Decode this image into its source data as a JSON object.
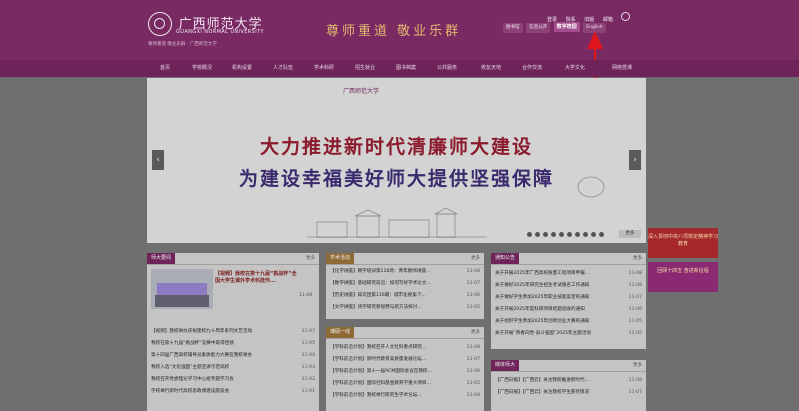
{
  "header": {
    "logo_cn": "广西师范大学",
    "logo_en": "GUANGXI NORMAL UNIVERSITY",
    "motto": "尊师重道 敬业乐群 · 广西师范大学",
    "slogan": "尊师重道  敬业乐群",
    "top_links": [
      "登录",
      "院系",
      "旧版",
      "邮箱"
    ],
    "toolbar": [
      "图书馆",
      "信息公开",
      "数字校园",
      "English"
    ],
    "toolbar_highlight": "数字校园"
  },
  "nav": {
    "items": [
      "首页",
      "学校概况",
      "机构设置",
      "人才队伍",
      "学术科研",
      "招生就业",
      "图书档案",
      "公共服务",
      "校友天地",
      "合作交流",
      "大学文化",
      "网络党课"
    ]
  },
  "banner": {
    "logo_text": "广西师范大学",
    "line1": "大力推进新时代清廉师大建设",
    "line2": "为建设幸福美好师大提供坚强保障",
    "prev": "‹",
    "next": "›",
    "more": "更多"
  },
  "news": {
    "title": "师大要闻",
    "more": "更多",
    "featured_title": "【视频】我校在第十九届“挑战杯”全国大学生课外学术科技作...",
    "featured_date": "11-08",
    "items": [
      {
        "t": "【视频】我校举办庆祝建校九十周年系列文艺活动",
        "d": "11-07"
      },
      {
        "t": "我校在第十九届“挑战杯”竞赛中取得佳绩",
        "d": "11-05"
      },
      {
        "t": "第十四届广西高校辅导员素质能力大赛在我校举办",
        "d": "11-04"
      },
      {
        "t": "我校入选“文化强国”主题宣讲示范高校",
        "d": "11-03"
      },
      {
        "t": "我校召开党委理论学习中心组专题学习会",
        "d": "11-02"
      },
      {
        "t": "学校举行新时代高校思政课建设座谈会",
        "d": "11-01"
      }
    ]
  },
  "academic": {
    "title": "学术活动",
    "more": "更多",
    "items": [
      {
        "t": "【化学讲座】教学培训第116场：青年教师讲座...",
        "d": "11-08"
      },
      {
        "t": "【数学讲座】基础研究前沿：如何写好学术论文...",
        "d": "11-07"
      },
      {
        "t": "【历史讲座】知识团第116期：城市化视角下...",
        "d": "11-06"
      },
      {
        "t": "【文学讲座】诗学研究新视野与新方法探讨...",
        "d": "11-05"
      }
    ]
  },
  "lecture": {
    "title": "博硕一线",
    "more": "更多",
    "items": [
      {
        "t": "【学科前沿计划】我校召开人文社科重点研究...",
        "d": "11-08"
      },
      {
        "t": "【学科前沿计划】新时代教育高质量发展论坛...",
        "d": "11-07"
      },
      {
        "t": "【学科前沿计划】第十一届ACM国际会议在我校...",
        "d": "11-06"
      },
      {
        "t": "【学科前沿计划】国际社科基金教育学重大项目...",
        "d": "11-05"
      },
      {
        "t": "【学科前沿计划】我校举行研究生学术论坛...",
        "d": "11-04"
      }
    ]
  },
  "notice": {
    "title": "通知公告",
    "more": "更多",
    "items": [
      {
        "t": "关于开展2025年广西高校质量工程项目申报...",
        "d": "11-08"
      },
      {
        "t": "关于做好2025年研究生招生考试报名工作通知",
        "d": "11-08"
      },
      {
        "t": "关于做好学生参加2025年职业技能鉴定的通知",
        "d": "11-07"
      },
      {
        "t": "关于开展2025年度科研项目结题验收的通知",
        "d": "11-06"
      },
      {
        "t": "关于组织学生参加2025年创新创业大赛的通知",
        "d": "11-05"
      },
      {
        "t": "关于开展“青春向党·奋斗强国”2025年主题活动",
        "d": "11-05"
      }
    ]
  },
  "media": {
    "title": "媒体师大",
    "more": "更多",
    "items": [
      {
        "t": "【广西日报】【广西云】关注我校推进新时代...",
        "d": "11-08"
      },
      {
        "t": "【广西日报】【广西云】关注我校学生获奖情况",
        "d": "11-07"
      }
    ]
  },
  "side_ads": [
    {
      "text": "深入贯彻中央八项规定精神学习教育"
    },
    {
      "text": "回顾十四五 奋进新征程"
    }
  ]
}
